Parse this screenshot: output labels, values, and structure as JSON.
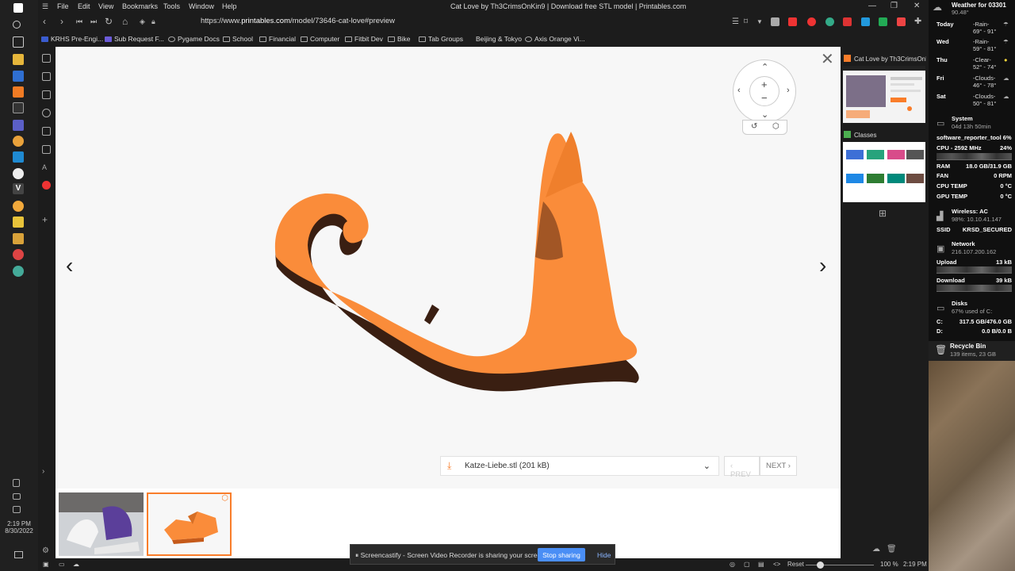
{
  "titlebar": {
    "menu": [
      "File",
      "Edit",
      "View",
      "Bookmarks",
      "Tools",
      "Window",
      "Help"
    ],
    "title": "Cat Love by Th3CrimsOnKin9 | Download free STL model | Printables.com"
  },
  "navbar": {
    "url_prefix": "https://www.",
    "url_domain": "printables.com",
    "url_path": "/model/73646-cat-love#preview"
  },
  "bookmarks": [
    "KRHS Pre-Engi...",
    "Sub Request F...",
    "Pygame Docs",
    "School",
    "Financial",
    "Computer",
    "Fitbit Dev",
    "Bike",
    "Tab Groups",
    "Beijing & Tokyo",
    "Axis Orange Vi..."
  ],
  "viewer": {
    "file_label": "Katze-Liebe.stl (201 kB)",
    "prev_label": "PREV",
    "next_label": "NEXT"
  },
  "panel": {
    "tab1_title": "Cat Love by Th3CrimsOnKin9",
    "tab2_title": "Classes"
  },
  "share": {
    "text": "Screencastify - Screen Video Recorder is sharing your screen.",
    "stop": "Stop sharing",
    "hide": "Hide"
  },
  "status": {
    "reset": "Reset",
    "zoom": "100 %",
    "time": "2:19 PM"
  },
  "clock": {
    "time": "2:19 PM",
    "date": "8/30/2022"
  },
  "weather": {
    "title": "Weather for 03301",
    "temp": "90.48°",
    "days": [
      {
        "day": "Today",
        "cond": "-Rain-",
        "range": "69° - 91°"
      },
      {
        "day": "Wed",
        "cond": "-Rain-",
        "range": "59° - 81°"
      },
      {
        "day": "Thu",
        "cond": "-Clear-",
        "range": "52° - 74°"
      },
      {
        "day": "Fri",
        "cond": "-Clouds-",
        "range": "46° - 78°"
      },
      {
        "day": "Sat",
        "cond": "-Clouds-",
        "range": "50° - 81°"
      }
    ]
  },
  "system": {
    "title": "System",
    "uptime": "04d 13h 50min",
    "process": "software_reporter_tool 6%",
    "cpu_label": "CPU - 2592 MHz",
    "cpu_val": "24%",
    "ram_label": "RAM",
    "ram_val": "18.0 GB/31.9 GB",
    "fan_label": "FAN",
    "fan_val": "0 RPM",
    "cputemp_label": "CPU TEMP",
    "cputemp_val": "0 °C",
    "gputemp_label": "GPU TEMP",
    "gputemp_val": "0 °C"
  },
  "wireless": {
    "title": "Wireless: AC",
    "sub": "98%: 10.10.41.147",
    "ssid_label": "SSID",
    "ssid_val": "KRSD_SECURED"
  },
  "network": {
    "title": "Network",
    "ip": "216.107.200.162",
    "up_label": "Upload",
    "up_val": "13 kB",
    "down_label": "Download",
    "down_val": "39 kB"
  },
  "disks": {
    "title": "Disks",
    "sub": "67% used of C:",
    "c_label": "C:",
    "c_val": "317.5 GB/476.0 GB",
    "d_label": "D:",
    "d_val": "0.0 B/0.0 B"
  },
  "recycle": {
    "title": "Recycle Bin",
    "sub": "139 items, 23 GB"
  },
  "colors": {
    "accent": "#f97d2a",
    "cat": "#fa8c3a",
    "cat_shadow": "#3a1f12"
  }
}
